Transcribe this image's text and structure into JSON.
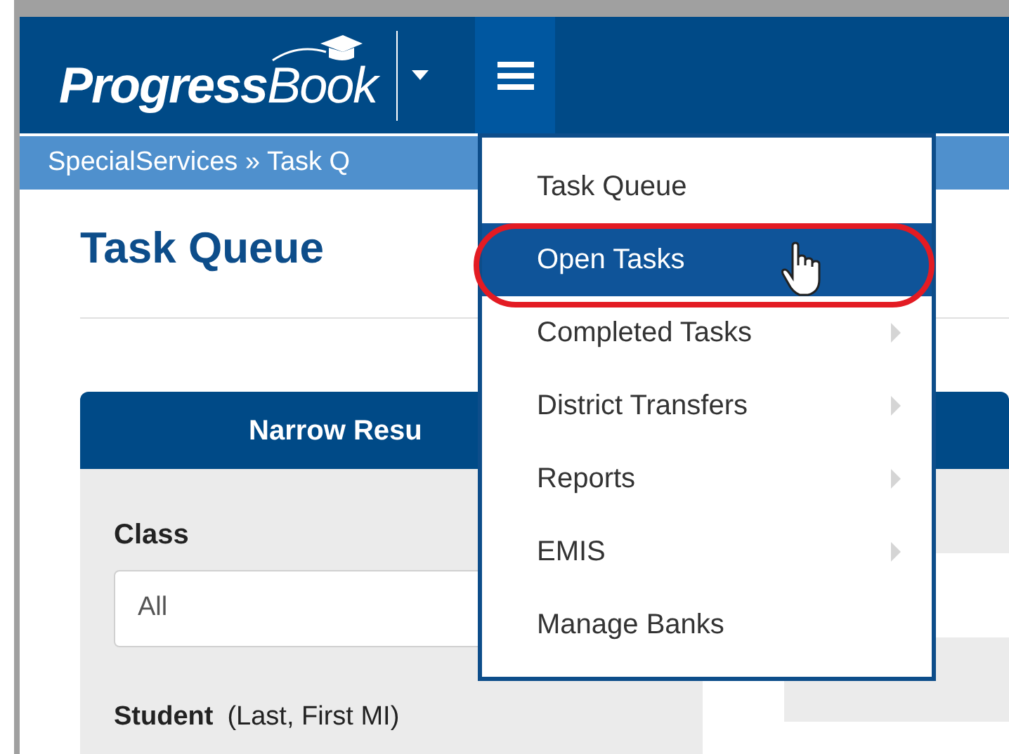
{
  "header": {
    "logo": "**Progress**Book"
  },
  "breadcrumb": "SpecialServices » Task Q",
  "page_title": "Task Queue",
  "filter_panel": {
    "title": "Narrow Resu",
    "class_label": "Class",
    "class_value": "All",
    "student_label": "Student",
    "student_hint": "(Last, First MI)"
  },
  "menu": [
    {
      "label": "Task Queue",
      "selected": false,
      "submenu": false
    },
    {
      "label": "Open Tasks",
      "selected": true,
      "submenu": false
    },
    {
      "label": "Completed Tasks",
      "selected": false,
      "submenu": true
    },
    {
      "label": "District Transfers",
      "selected": false,
      "submenu": true
    },
    {
      "label": "Reports",
      "selected": false,
      "submenu": true
    },
    {
      "label": "EMIS",
      "selected": false,
      "submenu": true
    },
    {
      "label": "Manage Banks",
      "selected": false,
      "submenu": false
    }
  ]
}
